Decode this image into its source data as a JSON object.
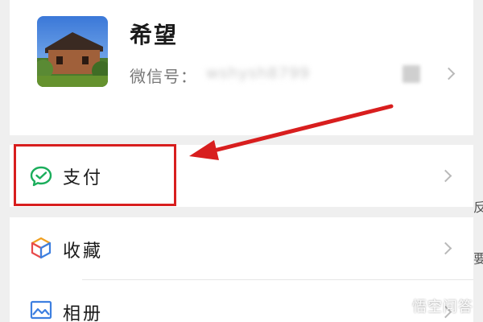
{
  "profile": {
    "name": "希望",
    "wechat_id_label": "微信号：",
    "wechat_id_value": "wshysh8799"
  },
  "menu": {
    "items": [
      {
        "label": "支付",
        "icon": "wechat-pay-icon"
      },
      {
        "label": "收藏",
        "icon": "favorites-cube-icon"
      },
      {
        "label": "相册",
        "icon": "album-icon"
      }
    ]
  },
  "edge_glyphs": [
    "反",
    "要"
  ],
  "watermark": {
    "text": "悟空问答",
    "icon": "wukong-cloud-icon"
  },
  "colors": {
    "annotation_red": "#d81e1e",
    "pay_green": "#1aad5b",
    "background": "#efefef"
  }
}
